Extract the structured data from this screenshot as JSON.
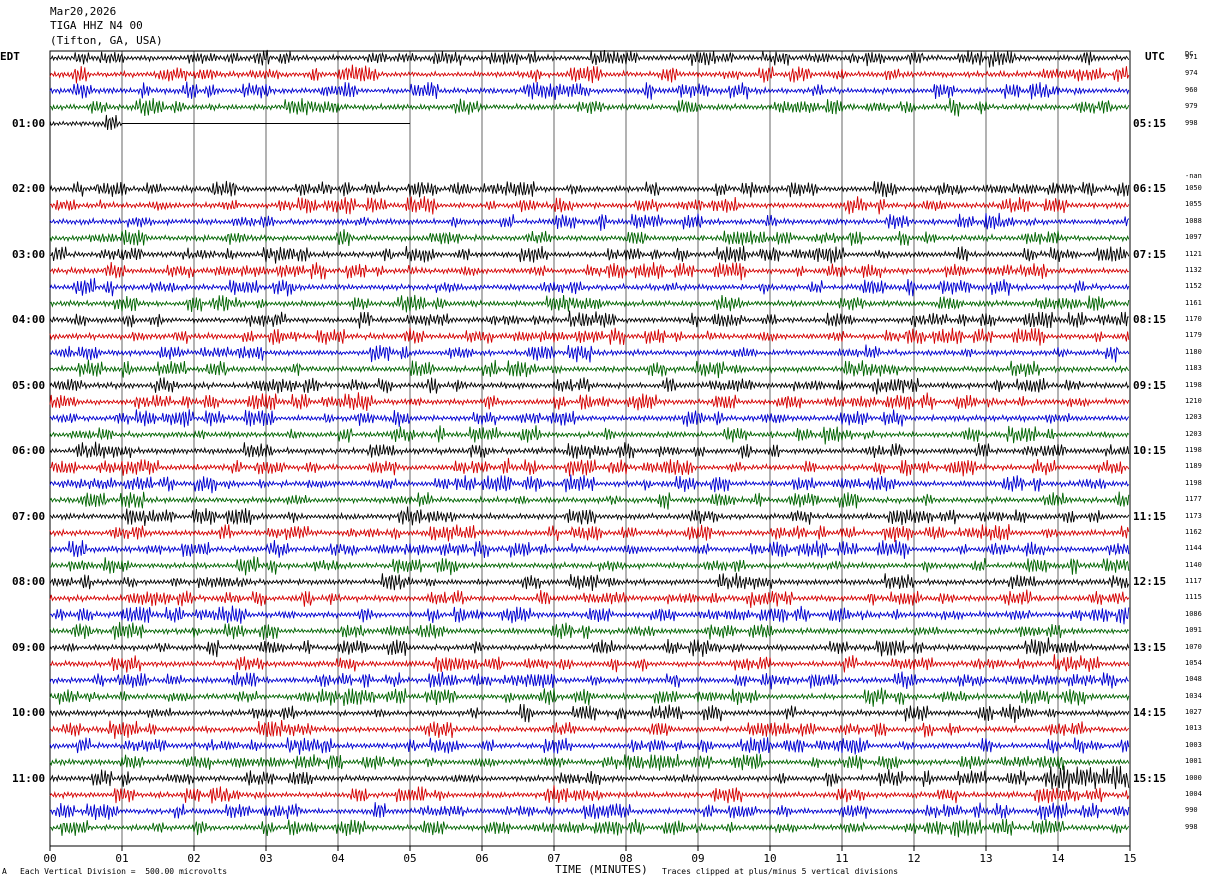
{
  "header": {
    "date": "Mar20,2026",
    "station": "TIGA HHZ N4 00",
    "location": "(Tifton, GA, USA)"
  },
  "left_axis_title": "EDT",
  "right_axis_title": "UTC",
  "dc_label": "DC",
  "gap_label": "-nan",
  "footer": {
    "scale": "Each Vertical Division =  500.00 microvolts",
    "clip": "Traces clipped at plus/minus 5 vertical divisions",
    "corner_mark": "A"
  },
  "colors": {
    "black": "#000000",
    "red": "#d40000",
    "blue": "#0000d0",
    "green": "#006400",
    "grid": "#000000"
  },
  "chart_data": {
    "type": "line",
    "title": "TIGA HHZ N4 00",
    "xlabel": "TIME (MINUTES)",
    "ylabel": "",
    "xlim": [
      0,
      15
    ],
    "x_ticks": [
      "00",
      "01",
      "02",
      "03",
      "04",
      "05",
      "06",
      "07",
      "08",
      "09",
      "10",
      "11",
      "12",
      "13",
      "14",
      "15"
    ],
    "left_hour_labels": [
      {
        "row": 4,
        "label": "01:00"
      },
      {
        "row": 8,
        "label": "02:00"
      },
      {
        "row": 12,
        "label": "03:00"
      },
      {
        "row": 16,
        "label": "04:00"
      },
      {
        "row": 20,
        "label": "05:00"
      },
      {
        "row": 24,
        "label": "06:00"
      },
      {
        "row": 28,
        "label": "07:00"
      },
      {
        "row": 32,
        "label": "08:00"
      },
      {
        "row": 36,
        "label": "09:00"
      },
      {
        "row": 40,
        "label": "10:00"
      },
      {
        "row": 44,
        "label": "11:00"
      }
    ],
    "right_hour_labels": [
      {
        "row": 4,
        "label": "05:15"
      },
      {
        "row": 8,
        "label": "06:15"
      },
      {
        "row": 12,
        "label": "07:15"
      },
      {
        "row": 16,
        "label": "08:15"
      },
      {
        "row": 20,
        "label": "09:15"
      },
      {
        "row": 24,
        "label": "10:15"
      },
      {
        "row": 28,
        "label": "11:15"
      },
      {
        "row": 32,
        "label": "12:15"
      },
      {
        "row": 36,
        "label": "13:15"
      },
      {
        "row": 40,
        "label": "14:15"
      },
      {
        "row": 44,
        "label": "15:15"
      }
    ],
    "rows": [
      {
        "dc": "971",
        "color": "black",
        "span": 15
      },
      {
        "dc": "974",
        "color": "red",
        "span": 15
      },
      {
        "dc": "960",
        "color": "blue",
        "span": 15
      },
      {
        "dc": "979",
        "color": "green",
        "span": 15
      },
      {
        "dc": "998",
        "color": "black",
        "span": 5,
        "partial_data_min": 1
      },
      {
        "dc": "",
        "color": "red",
        "span": 0
      },
      {
        "dc": "",
        "color": "blue",
        "span": 0
      },
      {
        "dc": "",
        "color": "green",
        "span": 0
      },
      {
        "dc": "1050",
        "color": "black",
        "span": 15
      },
      {
        "dc": "1055",
        "color": "red",
        "span": 15
      },
      {
        "dc": "1088",
        "color": "blue",
        "span": 15
      },
      {
        "dc": "1097",
        "color": "green",
        "span": 15
      },
      {
        "dc": "1121",
        "color": "black",
        "span": 15
      },
      {
        "dc": "1132",
        "color": "red",
        "span": 15
      },
      {
        "dc": "1152",
        "color": "blue",
        "span": 15
      },
      {
        "dc": "1161",
        "color": "green",
        "span": 15
      },
      {
        "dc": "1170",
        "color": "black",
        "span": 15
      },
      {
        "dc": "1179",
        "color": "red",
        "span": 15
      },
      {
        "dc": "1180",
        "color": "blue",
        "span": 15
      },
      {
        "dc": "1183",
        "color": "green",
        "span": 15
      },
      {
        "dc": "1198",
        "color": "black",
        "span": 15
      },
      {
        "dc": "1210",
        "color": "red",
        "span": 15
      },
      {
        "dc": "1203",
        "color": "blue",
        "span": 15
      },
      {
        "dc": "1203",
        "color": "green",
        "span": 15
      },
      {
        "dc": "1198",
        "color": "black",
        "span": 15
      },
      {
        "dc": "1189",
        "color": "red",
        "span": 15
      },
      {
        "dc": "1198",
        "color": "blue",
        "span": 15
      },
      {
        "dc": "1177",
        "color": "green",
        "span": 15
      },
      {
        "dc": "1173",
        "color": "black",
        "span": 15
      },
      {
        "dc": "1162",
        "color": "red",
        "span": 15
      },
      {
        "dc": "1144",
        "color": "blue",
        "span": 15
      },
      {
        "dc": "1140",
        "color": "green",
        "span": 15
      },
      {
        "dc": "1117",
        "color": "black",
        "span": 15
      },
      {
        "dc": "1115",
        "color": "red",
        "span": 15
      },
      {
        "dc": "1086",
        "color": "blue",
        "span": 15
      },
      {
        "dc": "1091",
        "color": "green",
        "span": 15
      },
      {
        "dc": "1070",
        "color": "black",
        "span": 15
      },
      {
        "dc": "1054",
        "color": "red",
        "span": 15
      },
      {
        "dc": "1048",
        "color": "blue",
        "span": 15
      },
      {
        "dc": "1034",
        "color": "green",
        "span": 15
      },
      {
        "dc": "1027",
        "color": "black",
        "span": 15
      },
      {
        "dc": "1013",
        "color": "red",
        "span": 15
      },
      {
        "dc": "1003",
        "color": "blue",
        "span": 15
      },
      {
        "dc": "1001",
        "color": "green",
        "span": 15
      },
      {
        "dc": "1000",
        "color": "black",
        "span": 15,
        "event_start_min": 13.8
      },
      {
        "dc": "1004",
        "color": "red",
        "span": 15
      },
      {
        "dc": "990",
        "color": "blue",
        "span": 15
      },
      {
        "dc": "998",
        "color": "green",
        "span": 15
      }
    ]
  }
}
